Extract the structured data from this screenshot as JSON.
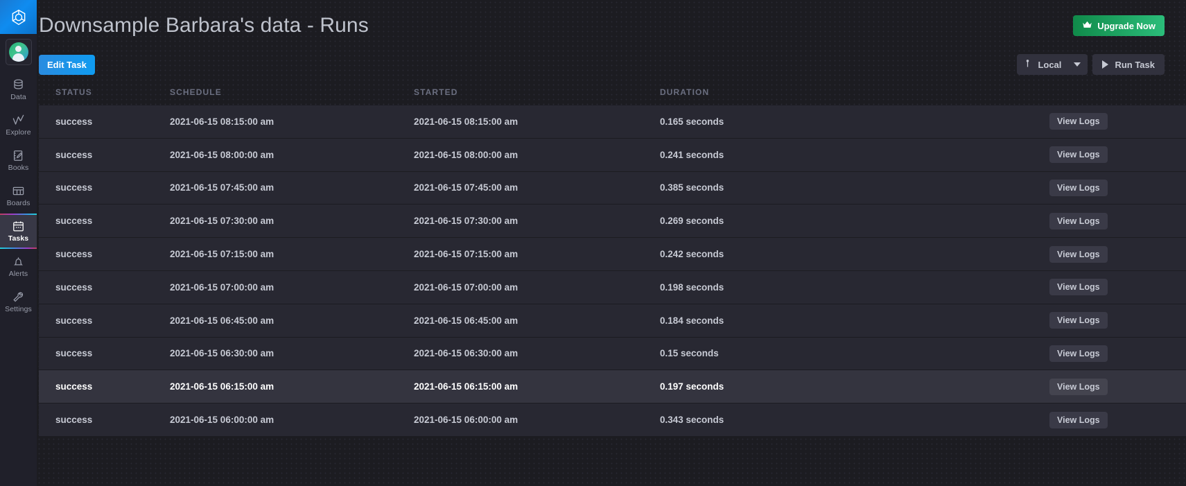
{
  "sidebar": {
    "logo_name": "influxdb-logo",
    "avatar_name": "user-avatar",
    "items": [
      {
        "label": "Data",
        "icon": "database-icon",
        "active": false
      },
      {
        "label": "Explore",
        "icon": "graph-line-icon",
        "active": false
      },
      {
        "label": "Books",
        "icon": "notebook-pencil-icon",
        "active": false
      },
      {
        "label": "Boards",
        "icon": "dashboard-grid-icon",
        "active": false
      },
      {
        "label": "Tasks",
        "icon": "calendar-icon",
        "active": true
      },
      {
        "label": "Alerts",
        "icon": "bell-icon",
        "active": false
      },
      {
        "label": "Settings",
        "icon": "wrench-icon",
        "active": false
      }
    ]
  },
  "header": {
    "title": "Downsample Barbara's data - Runs",
    "upgrade_label": "Upgrade Now",
    "upgrade_icon": "crown-icon",
    "upgrade_color": "#2bbd7a"
  },
  "toolbar": {
    "edit_task_label": "Edit Task",
    "edit_task_color": "#0f9bf0",
    "timezone_value": "Local",
    "timezone_icon": "clock-icon",
    "run_task_label": "Run Task",
    "run_task_icon": "play-icon"
  },
  "table": {
    "columns": [
      "STATUS",
      "SCHEDULE",
      "STARTED",
      "DURATION",
      ""
    ],
    "action_label": "View Logs",
    "rows": [
      {
        "status": "success",
        "schedule": "2021-06-15 08:15:00 am",
        "started": "2021-06-15 08:15:00 am",
        "duration": "0.165 seconds",
        "hovered": false
      },
      {
        "status": "success",
        "schedule": "2021-06-15 08:00:00 am",
        "started": "2021-06-15 08:00:00 am",
        "duration": "0.241 seconds",
        "hovered": false
      },
      {
        "status": "success",
        "schedule": "2021-06-15 07:45:00 am",
        "started": "2021-06-15 07:45:00 am",
        "duration": "0.385 seconds",
        "hovered": false
      },
      {
        "status": "success",
        "schedule": "2021-06-15 07:30:00 am",
        "started": "2021-06-15 07:30:00 am",
        "duration": "0.269 seconds",
        "hovered": false
      },
      {
        "status": "success",
        "schedule": "2021-06-15 07:15:00 am",
        "started": "2021-06-15 07:15:00 am",
        "duration": "0.242 seconds",
        "hovered": false
      },
      {
        "status": "success",
        "schedule": "2021-06-15 07:00:00 am",
        "started": "2021-06-15 07:00:00 am",
        "duration": "0.198 seconds",
        "hovered": false
      },
      {
        "status": "success",
        "schedule": "2021-06-15 06:45:00 am",
        "started": "2021-06-15 06:45:00 am",
        "duration": "0.184 seconds",
        "hovered": false
      },
      {
        "status": "success",
        "schedule": "2021-06-15 06:30:00 am",
        "started": "2021-06-15 06:30:00 am",
        "duration": "0.15 seconds",
        "hovered": false
      },
      {
        "status": "success",
        "schedule": "2021-06-15 06:15:00 am",
        "started": "2021-06-15 06:15:00 am",
        "duration": "0.197 seconds",
        "hovered": true
      },
      {
        "status": "success",
        "schedule": "2021-06-15 06:00:00 am",
        "started": "2021-06-15 06:00:00 am",
        "duration": "0.343 seconds",
        "hovered": false
      }
    ]
  }
}
